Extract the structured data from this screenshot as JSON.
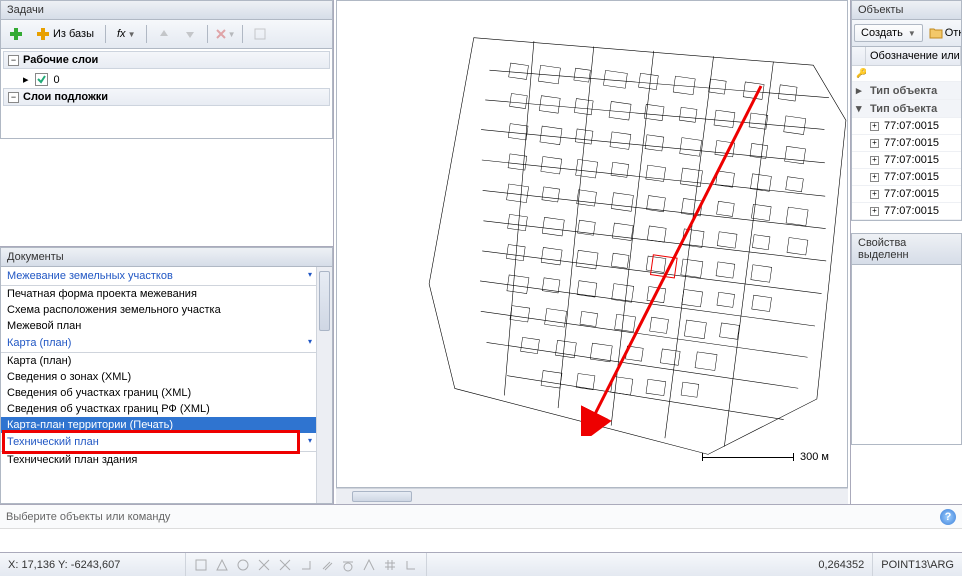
{
  "tasks": {
    "title": "Задачи",
    "fromBaseLabel": "Из базы",
    "fxLabel": "fx",
    "groups": {
      "work": {
        "label": "Рабочие слои",
        "layer0": "0"
      },
      "base": {
        "label": "Слои подложки"
      }
    }
  },
  "documents": {
    "title": "Документы",
    "groups": {
      "g1": "Межевание земельных участков",
      "g2": "Карта (план)",
      "g3": "Технический план"
    },
    "items": {
      "i1": "Печатная форма проекта межевания",
      "i2": "Схема расположения земельного участка",
      "i3": "Межевой план",
      "i4": "Карта (план)",
      "i5": "Сведения о зонах (XML)",
      "i6": "Сведения об участках границ (XML)",
      "i7": "Сведения об участках границ РФ (XML)",
      "i8": "Карта-план территории (Печать)",
      "i9": "Технический план здания"
    }
  },
  "canvas": {
    "scaleLabel": "300 м"
  },
  "objects": {
    "title": "Объекты",
    "createLabel": "Создать",
    "openLabel": "Откр",
    "header": "Обозначение или",
    "typeLabel": "Тип объекта",
    "rows": [
      "77:07:0015",
      "77:07:0015",
      "77:07:0015",
      "77:07:0015",
      "77:07:0015",
      "77:07:0015"
    ]
  },
  "props": {
    "title": "Свойства выделенн"
  },
  "cmd": {
    "prompt": "Выберите объекты или команду"
  },
  "status": {
    "coords": "X: 17,136 Y: -6243,607",
    "ratio": "0,264352",
    "path": "POINT13\\ARG"
  }
}
